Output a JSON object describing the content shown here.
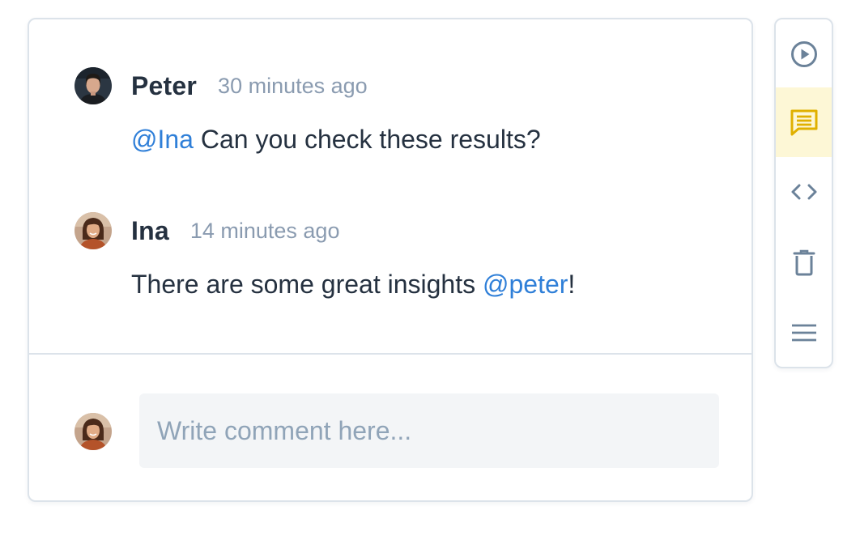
{
  "comments": [
    {
      "author": "Peter",
      "time": "30 minutes ago",
      "mention": "@Ina",
      "text": " Can you check these results?"
    },
    {
      "author": "Ina",
      "time": "14 minutes ago",
      "text_before": "There are some great insights ",
      "mention": "@peter",
      "text_after": "!"
    }
  ],
  "composer": {
    "placeholder": "Write comment here..."
  },
  "toolbar": {
    "items": [
      {
        "icon": "play-circle-icon",
        "active": false
      },
      {
        "icon": "comment-icon",
        "active": true
      },
      {
        "icon": "code-icon",
        "active": false
      },
      {
        "icon": "trash-icon",
        "active": false
      },
      {
        "icon": "menu-icon",
        "active": false
      }
    ]
  },
  "colors": {
    "text": "#253140",
    "muted": "#8a9bb0",
    "mention": "#2f7fd8",
    "border": "#dce3ea",
    "active_bg": "#fdf7d6",
    "active_icon": "#e0b000",
    "icon": "#6b8299"
  }
}
